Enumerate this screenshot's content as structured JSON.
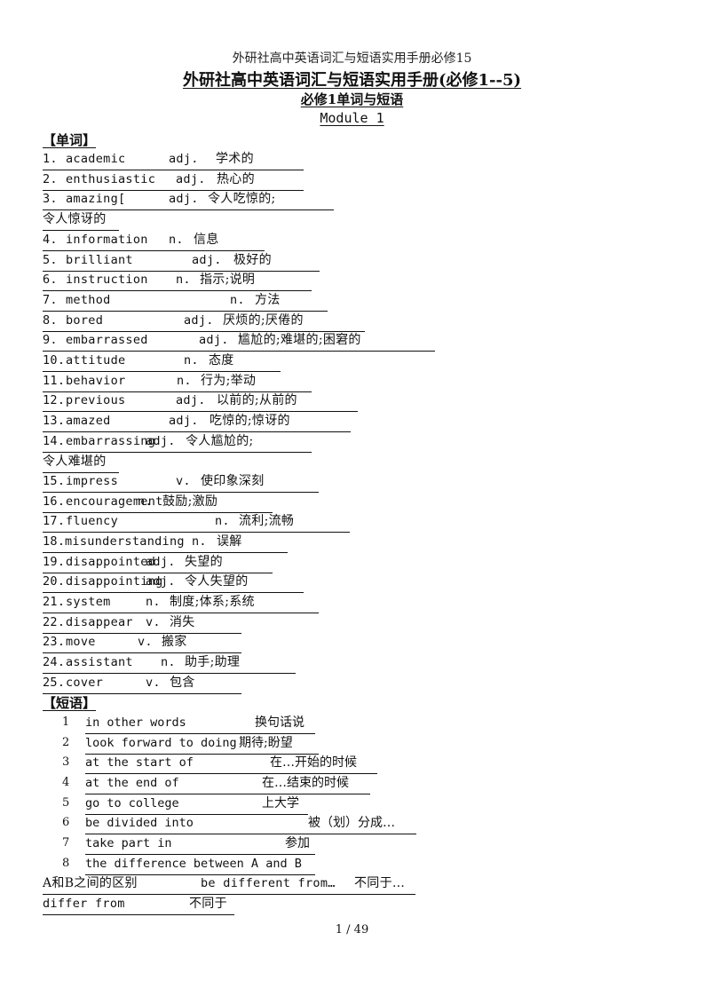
{
  "header_note": "外研社高中英语词汇与短语实用手册必修15",
  "title": "外研社高中英语词汇与短语实用手册(必修1--5)",
  "subtitle": "必修1单词与短语",
  "module": "Module 1",
  "words_section": {
    "heading": "【单词】",
    "items": [
      {
        "num": "1.",
        "word": "academic",
        "pos": "adj.",
        "meaning": "学术的"
      },
      {
        "num": "2.",
        "word": "enthusiastic",
        "pos": "adj.",
        "meaning": "热心的"
      },
      {
        "num": "3.",
        "word": "amazing[",
        "pos": "adj.",
        "meaning": "令人吃惊的;",
        "continuation": "令人惊讶的"
      },
      {
        "num": "4.",
        "word": "information",
        "pos": "n.",
        "meaning": "信息"
      },
      {
        "num": "5.",
        "word": "brilliant",
        "pos": "adj.",
        "meaning": "极好的"
      },
      {
        "num": "6.",
        "word": "instruction",
        "pos": "n.",
        "meaning": "指示;说明"
      },
      {
        "num": "7.",
        "word": "method",
        "pos": "n.",
        "meaning": "方法"
      },
      {
        "num": "8.",
        "word": "bored",
        "pos": "adj.",
        "meaning": "厌烦的;厌倦的"
      },
      {
        "num": "9.",
        "word": "embarrassed",
        "pos": "adj.",
        "meaning": "尴尬的;难堪的;困窘的"
      },
      {
        "num": "10.",
        "word": "attitude",
        "pos": "n.",
        "meaning": "态度"
      },
      {
        "num": "11.",
        "word": "behavior",
        "pos": "n.",
        "meaning": "行为;举动"
      },
      {
        "num": "12.",
        "word": "previous",
        "pos": "adj.",
        "meaning": "以前的;从前的"
      },
      {
        "num": "13.",
        "word": "amazed",
        "pos": "adj.",
        "meaning": "吃惊的;惊讶的"
      },
      {
        "num": "14.",
        "word": "embarrassing",
        "pos": "adj.",
        "meaning": "令人尴尬的;",
        "continuation": "令人难堪的"
      },
      {
        "num": "15.",
        "word": "impress",
        "pos": "v.",
        "meaning": "使印象深刻"
      },
      {
        "num": "16.",
        "word": "encouragement",
        "pos": "n.",
        "meaning": "鼓励;激励"
      },
      {
        "num": "17.",
        "word": "fluency",
        "pos": "n.",
        "meaning": "流利;流畅"
      },
      {
        "num": "18.",
        "word": "misunderstanding",
        "pos": "n.",
        "meaning": "误解"
      },
      {
        "num": "19.",
        "word": "disappointed",
        "pos": "adj.",
        "meaning": "失望的"
      },
      {
        "num": "20.",
        "word": "disappointing",
        "pos": "adj.",
        "meaning": "令人失望的"
      },
      {
        "num": "21.",
        "word": "system",
        "pos": "n.",
        "meaning": "制度;体系;系统"
      },
      {
        "num": "22.",
        "word": "disappear",
        "pos": "v.",
        "meaning": "消失"
      },
      {
        "num": "23.",
        "word": "move",
        "pos": "v.",
        "meaning": "搬家"
      },
      {
        "num": "24.",
        "word": "assistant",
        "pos": "n.",
        "meaning": "助手;助理"
      },
      {
        "num": "25.",
        "word": "cover",
        "pos": "v.",
        "meaning": "包含"
      }
    ]
  },
  "phrases_section": {
    "heading": "【短语】",
    "items": [
      {
        "num": "1",
        "phrase": "in other words",
        "meaning": "换句话说"
      },
      {
        "num": "2",
        "phrase": "look forward to doing",
        "meaning": "期待;盼望"
      },
      {
        "num": "3",
        "phrase": "at the start of",
        "meaning": "在…开始的时候"
      },
      {
        "num": "4",
        "phrase": "at the end of",
        "meaning": "在…结束的时候"
      },
      {
        "num": "5",
        "phrase": "go to college",
        "meaning": "上大学"
      },
      {
        "num": "6",
        "phrase": "be divided into",
        "meaning": "被（划）分成…"
      },
      {
        "num": "7",
        "phrase": "take part in",
        "meaning": "参加"
      },
      {
        "num": "8",
        "phrase": "the difference between A and B",
        "meaning": ""
      }
    ],
    "extra_lines": [
      {
        "left_cn": "A和B之间的区别",
        "phrase": "be different from…",
        "meaning": "不同于…"
      },
      {
        "phrase": "differ from",
        "meaning": "不同于"
      }
    ]
  },
  "footer": {
    "page": "1 / 49"
  }
}
